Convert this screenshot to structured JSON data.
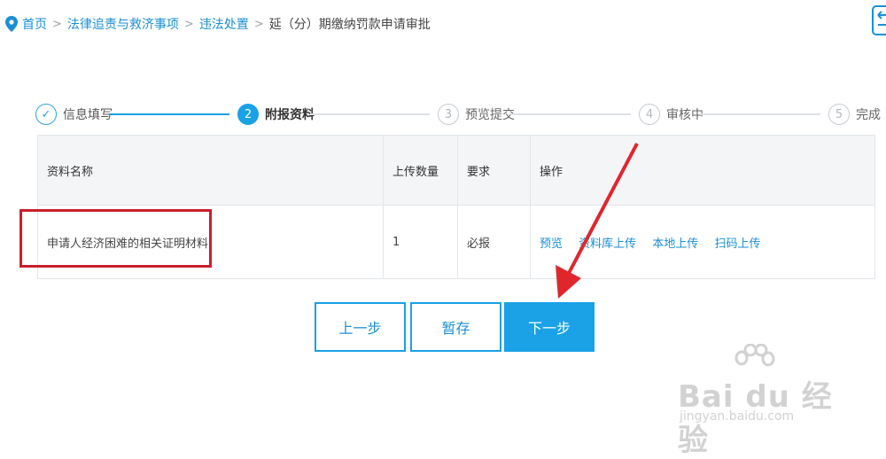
{
  "breadcrumb": {
    "items": [
      "首页",
      "法律追责与救济事项",
      "违法处置"
    ],
    "current": "延（分）期缴纳罚款申请审批"
  },
  "steps": [
    {
      "number": "✓",
      "label": "信息填写",
      "state": "done"
    },
    {
      "number": "2",
      "label": "附报资料",
      "state": "active"
    },
    {
      "number": "3",
      "label": "预览提交",
      "state": "todo"
    },
    {
      "number": "4",
      "label": "审核中",
      "state": "todo"
    },
    {
      "number": "5",
      "label": "完成",
      "state": "todo"
    }
  ],
  "table": {
    "headers": [
      "资料名称",
      "上传数量",
      "要求",
      "操作"
    ],
    "rows": [
      {
        "name": "申请人经济困难的相关证明材料",
        "count": "1",
        "requirement": "必报",
        "actions": [
          "预览",
          "资料库上传",
          "本地上传",
          "扫码上传"
        ]
      }
    ]
  },
  "buttons": {
    "prev": "上一步",
    "save": "暂存",
    "next": "下一步"
  },
  "watermark": {
    "brand": "Bai du 经验",
    "url": "jingyan.baidu.com"
  },
  "colors": {
    "accent": "#1aa1e6",
    "link": "#1a8fd6",
    "highlight": "#c8202c",
    "arrow": "#e0262d"
  }
}
